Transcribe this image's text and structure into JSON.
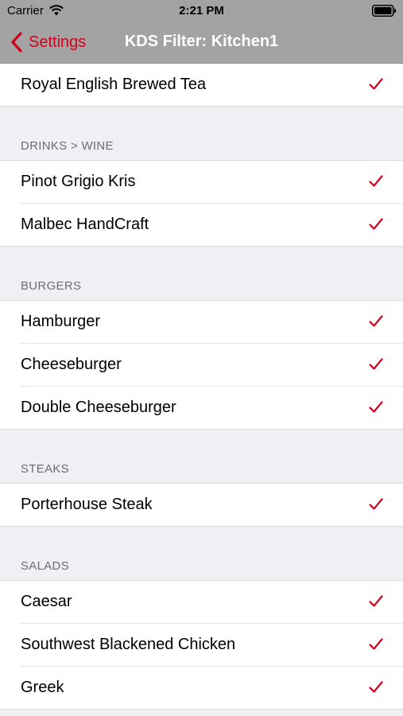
{
  "status_bar": {
    "carrier": "Carrier",
    "time": "2:21 PM"
  },
  "nav": {
    "back_label": "Settings",
    "title": "KDS Filter: Kitchen1"
  },
  "colors": {
    "accent": "#d0021b",
    "bar": "#a3a3a3",
    "background": "#efeff4"
  },
  "top_item": {
    "label": "Royal English Brewed Tea",
    "checked": true
  },
  "sections": [
    {
      "title": "DRINKS > WINE",
      "items": [
        {
          "label": "Pinot Grigio Kris",
          "checked": true
        },
        {
          "label": "Malbec HandCraft",
          "checked": true
        }
      ]
    },
    {
      "title": "BURGERS",
      "items": [
        {
          "label": "Hamburger",
          "checked": true
        },
        {
          "label": "Cheeseburger",
          "checked": true
        },
        {
          "label": "Double Cheeseburger",
          "checked": true
        }
      ]
    },
    {
      "title": "STEAKS",
      "items": [
        {
          "label": "Porterhouse Steak",
          "checked": true
        }
      ]
    },
    {
      "title": "SALADS",
      "items": [
        {
          "label": "Caesar",
          "checked": true
        },
        {
          "label": "Southwest Blackened Chicken",
          "checked": true
        },
        {
          "label": "Greek",
          "checked": true
        }
      ]
    }
  ]
}
